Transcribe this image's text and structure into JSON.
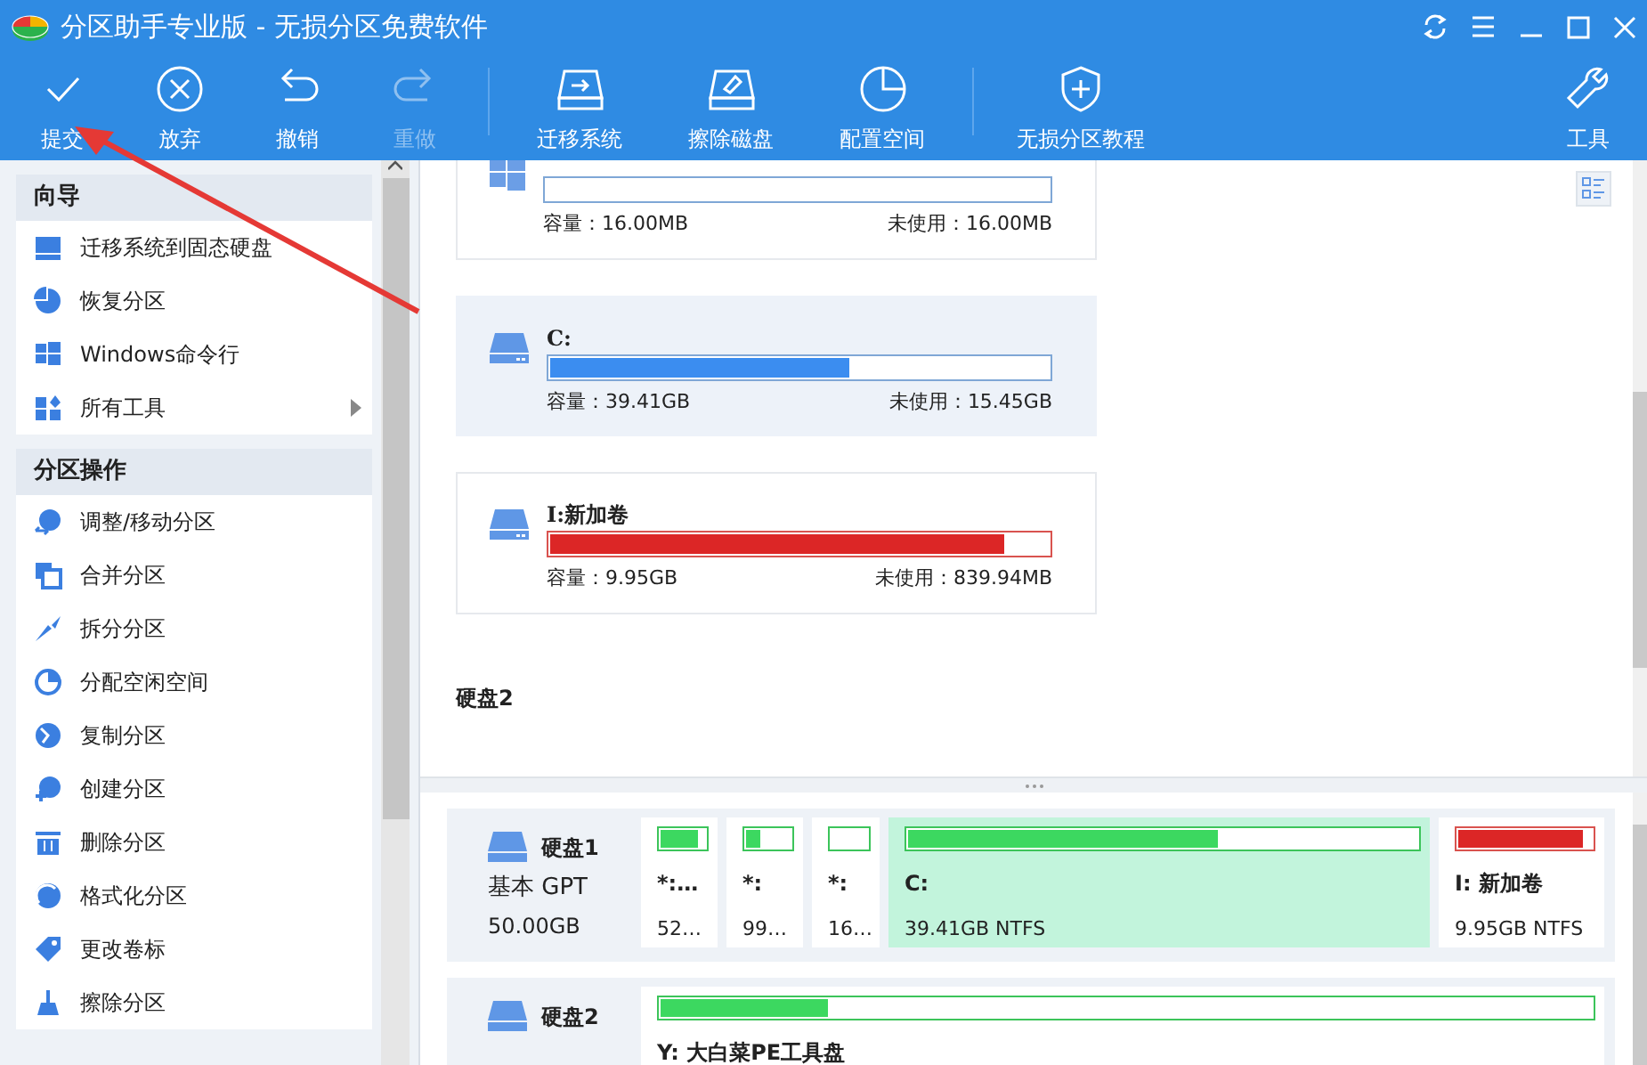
{
  "window": {
    "title": "分区助手专业版 - 无损分区免费软件"
  },
  "toolbar": {
    "groups": [
      [
        {
          "label": "提交",
          "disabled": false
        },
        {
          "label": "放弃",
          "disabled": false
        },
        {
          "label": "撤销",
          "disabled": false
        },
        {
          "label": "重做",
          "disabled": true
        }
      ],
      [
        {
          "label": "迁移系统",
          "disabled": false
        },
        {
          "label": "擦除磁盘",
          "disabled": false
        },
        {
          "label": "配置空间",
          "disabled": false
        }
      ],
      [
        {
          "label": "无损分区教程",
          "disabled": false
        }
      ]
    ],
    "end": {
      "label": "工具",
      "disabled": false
    }
  },
  "sidebar": {
    "sections": [
      {
        "title": "向导",
        "items": [
          {
            "label": "迁移系统到固态硬盘",
            "has_submenu": false
          },
          {
            "label": "恢复分区",
            "has_submenu": false
          },
          {
            "label": "Windows命令行",
            "has_submenu": false
          },
          {
            "label": "所有工具",
            "has_submenu": true
          }
        ]
      },
      {
        "title": "分区操作",
        "items": [
          {
            "label": "调整/移动分区",
            "has_submenu": false
          },
          {
            "label": "合并分区",
            "has_submenu": false
          },
          {
            "label": "拆分分区",
            "has_submenu": false
          },
          {
            "label": "分配空闲空间",
            "has_submenu": false
          },
          {
            "label": "复制分区",
            "has_submenu": false
          },
          {
            "label": "创建分区",
            "has_submenu": false
          },
          {
            "label": "删除分区",
            "has_submenu": false
          },
          {
            "label": "格式化分区",
            "has_submenu": false
          },
          {
            "label": "更改卷标",
            "has_submenu": false
          },
          {
            "label": "擦除分区",
            "has_submenu": false
          }
        ]
      }
    ]
  },
  "partitions": [
    {
      "kind": "system",
      "selected": false,
      "capacity": "容量：16.00MB",
      "unused": "未使用：16.00MB"
    },
    {
      "kind": "drive",
      "label": "C:",
      "selected": true,
      "level": 0.6,
      "color": "#3b8df0",
      "capacity": "容量：39.41GB",
      "unused": "未使用：15.45GB"
    },
    {
      "kind": "drive",
      "label": "I:新加卷",
      "selected": false,
      "level": 0.91,
      "color": "#dc2626",
      "capacity": "容量：9.95GB",
      "unused": "未使用：839.94MB"
    }
  ],
  "next_disk_title": "硬盘2",
  "disks": [
    {
      "name": "硬盘1",
      "type": "基本 GPT",
      "size": "50.00GB",
      "partitions": [
        {
          "label": "*:…",
          "info": "52…",
          "level": 0.85,
          "color": "#3cd860",
          "selected": false
        },
        {
          "label": "*:",
          "info": "99…",
          "level": 0.3,
          "color": "#3cd860",
          "selected": false
        },
        {
          "label": "*:",
          "info": "16…",
          "selected": false
        },
        {
          "label": "C:",
          "info": "39.41GB NTFS",
          "level": 0.61,
          "color": "#3cd860",
          "selected": true
        },
        {
          "label": "I: 新加卷",
          "info": "9.95GB NTFS",
          "level": 0.93,
          "color": "#dc2626",
          "selected": false
        }
      ]
    },
    {
      "name": "硬盘2",
      "partitions": [
        {
          "label": "Y: 大白菜PE工具盘",
          "level": 0.18,
          "color": "#3cd860",
          "selected": false
        }
      ]
    }
  ]
}
